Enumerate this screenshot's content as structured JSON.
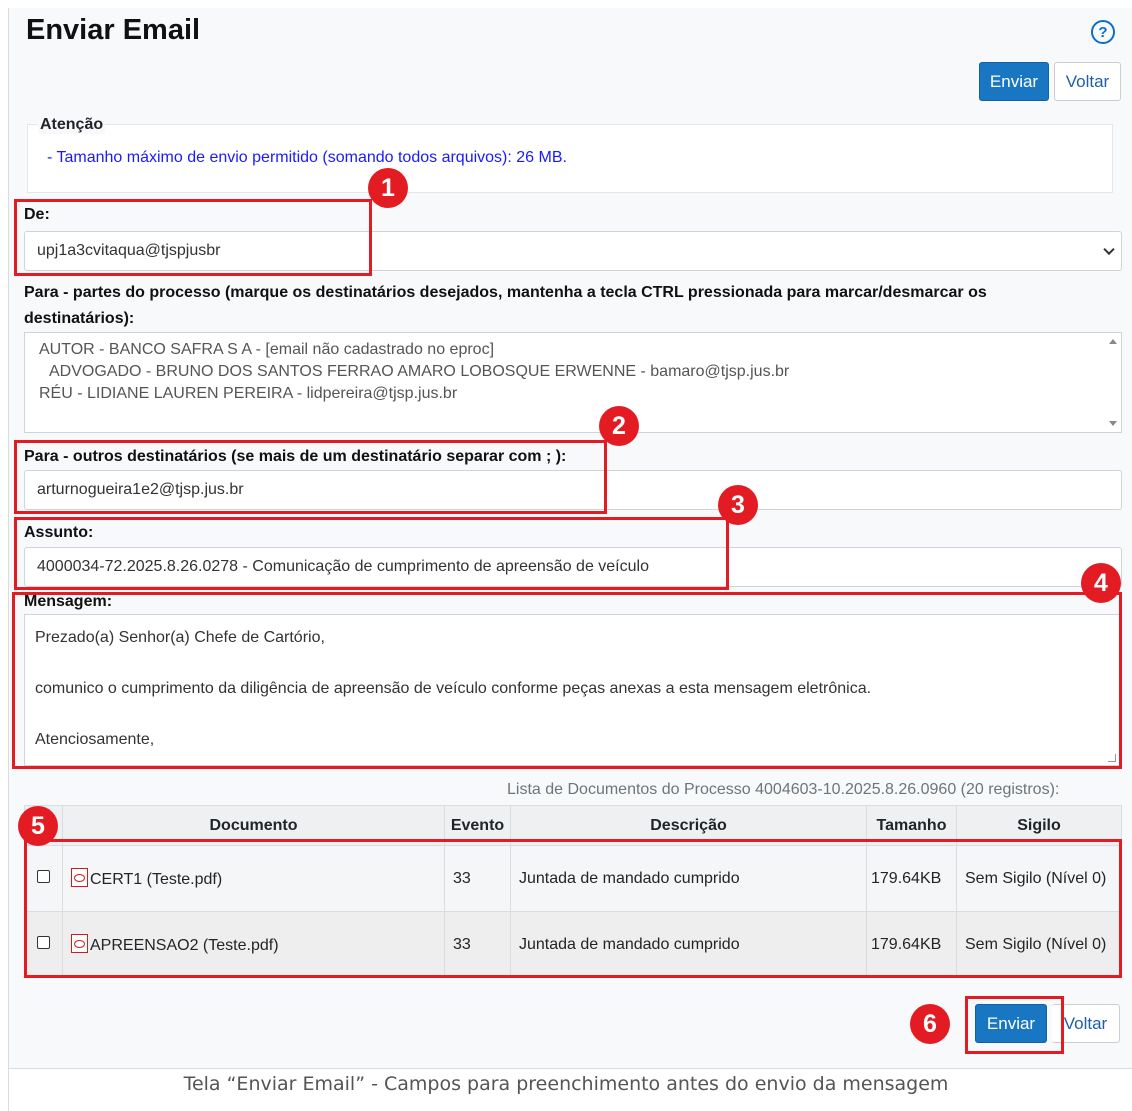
{
  "page": {
    "title": "Enviar Email",
    "help_icon_glyph": "?"
  },
  "toolbar": {
    "send_label": "Enviar",
    "back_label": "Voltar"
  },
  "notice": {
    "heading": "Atenção",
    "text": "- Tamanho máximo de envio permitido (somando todos arquivos): 26 MB."
  },
  "from": {
    "label": "De:",
    "value": "upj1a3cvitaqua@tjspjusbr"
  },
  "to_parties": {
    "label_line1": "Para - partes do processo (marque os destinatários desejados, mantenha a tecla CTRL pressionada para marcar/desmarcar os",
    "label_line2": "destinatários):",
    "options": [
      "AUTOR - BANCO SAFRA S A - [email não cadastrado no eproc]",
      "ADVOGADO - BRUNO DOS SANTOS FERRAO AMARO LOBOSQUE ERWENNE - bamaro@tjsp.jus.br",
      "RÉU - LIDIANE LAUREN PEREIRA - lidpereira@tjsp.jus.br"
    ]
  },
  "to_others": {
    "label": "Para - outros destinatários (se mais de um destinatário separar com ; ):",
    "value": "arturnogueira1e2@tjsp.jus.br"
  },
  "subject": {
    "label": "Assunto:",
    "value": "4000034-72.2025.8.26.0278 - Comunicação de cumprimento de apreensão de veículo"
  },
  "message": {
    "label": "Mensagem:",
    "lines": [
      "Prezado(a) Senhor(a) Chefe de Cartório,",
      "comunico o cumprimento da diligência de apreensão de veículo conforme peças anexas a esta mensagem eletrônica.",
      "Atenciosamente,"
    ]
  },
  "documents": {
    "caption": "Lista de Documentos do Processo 4004603-10.2025.8.26.0960 (20 registros):",
    "headers": [
      "",
      "Documento",
      "Evento",
      "Descrição",
      "Tamanho",
      "Sigilo"
    ],
    "rows": [
      {
        "name": "CERT1 (Teste.pdf)",
        "event": "33",
        "description": "Juntada de mandado cumprido",
        "size": "179.64KB",
        "secrecy": "Sem Sigilo (Nível 0)"
      },
      {
        "name": "APREENSAO2 (Teste.pdf)",
        "event": "33",
        "description": "Juntada de mandado cumprido",
        "size": "179.64KB",
        "secrecy": "Sem Sigilo (Nível 0)"
      }
    ]
  },
  "markers": [
    "1",
    "2",
    "3",
    "4",
    "5",
    "6"
  ],
  "figure_caption": "Tela “Enviar Email” - Campos para preenchimento antes do envio da mensagem",
  "colors": {
    "primary_button": "#1976c2",
    "marker_red": "#e31b23",
    "notice_text": "#1a1aff"
  }
}
